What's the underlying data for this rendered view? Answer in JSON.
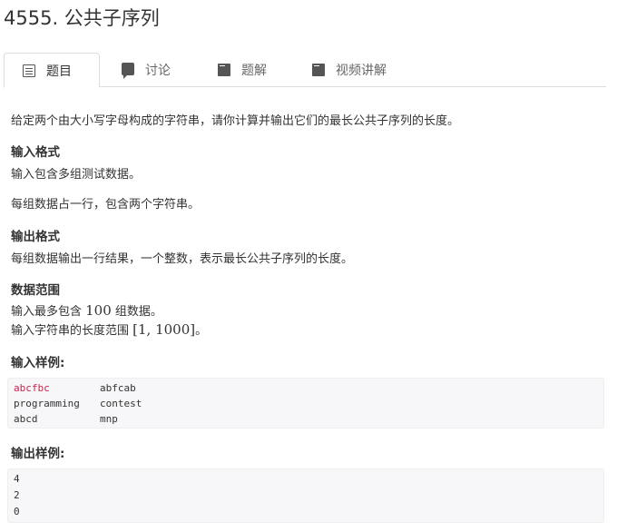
{
  "problem": {
    "title": "4555. 公共子序列"
  },
  "tabs": [
    {
      "label": "题目",
      "icon": "document-icon",
      "active": true
    },
    {
      "label": "讨论",
      "icon": "comment-icon",
      "active": false
    },
    {
      "label": "题解",
      "icon": "book-icon",
      "active": false
    },
    {
      "label": "视频讲解",
      "icon": "book-icon",
      "active": false
    }
  ],
  "description": "给定两个由大小写字母构成的字符串，请你计算并输出它们的最长公共子序列的长度。",
  "input_format": {
    "heading": "输入格式",
    "line1": "输入包含多组测试数据。",
    "line2": "每组数据占一行，包含两个字符串。"
  },
  "output_format": {
    "heading": "输出格式",
    "line1": "每组数据输出一行结果，一个整数，表示最长公共子序列的长度。"
  },
  "data_range": {
    "heading": "数据范围",
    "line1_pre": "输入最多包含 ",
    "line1_num": "100",
    "line1_post": " 组数据。",
    "line2_pre": "输入字符串的长度范围 ",
    "line2_range": "[1, 1000]",
    "line2_post": "。"
  },
  "sample_input": {
    "heading": "输入样例:",
    "rows": [
      [
        "abcfbc",
        "abfcab"
      ],
      [
        "programming",
        "contest"
      ],
      [
        "abcd",
        "mnp"
      ]
    ]
  },
  "sample_output": {
    "heading": "输出样例:",
    "rows": [
      "4",
      "2",
      "0"
    ]
  }
}
